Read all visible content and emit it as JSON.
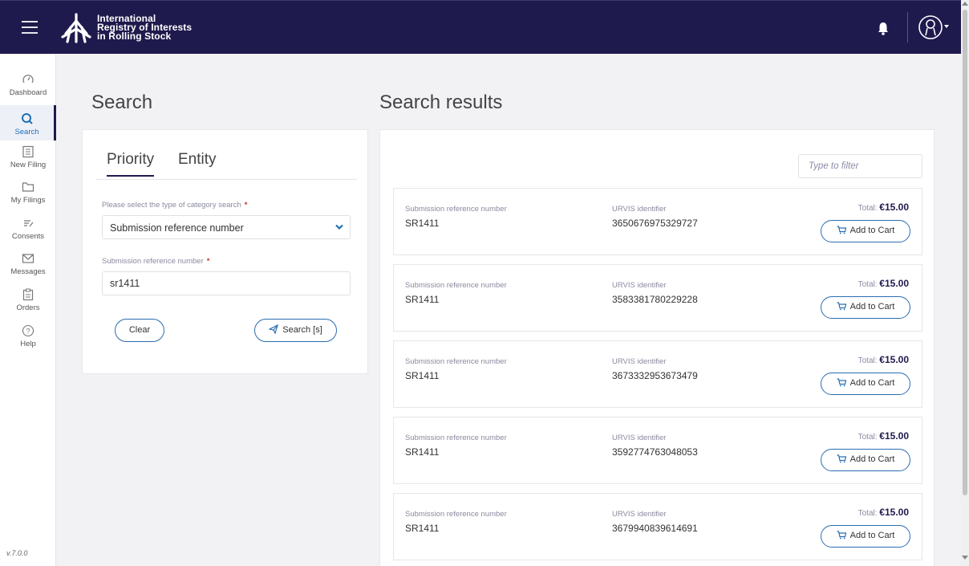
{
  "header": {
    "brand_line1": "International",
    "brand_line2": "Registry of Interests",
    "brand_line3": "in Rolling Stock"
  },
  "sidebar": {
    "items": [
      {
        "label": "Dashboard",
        "icon": "dashboard-icon"
      },
      {
        "label": "Search",
        "icon": "search-icon",
        "active": true
      },
      {
        "label": "New Filing",
        "icon": "new-filing-icon"
      },
      {
        "label": "My Filings",
        "icon": "folder-icon"
      },
      {
        "label": "Consents",
        "icon": "consents-icon"
      },
      {
        "label": "Messages",
        "icon": "envelope-icon"
      },
      {
        "label": "Orders",
        "icon": "clipboard-icon"
      },
      {
        "label": "Help",
        "icon": "help-icon"
      }
    ],
    "version": "v.7.0.0"
  },
  "search": {
    "title": "Search",
    "tabs": [
      "Priority",
      "Entity"
    ],
    "category_label": "Please select the type of category search",
    "category_value": "Submission reference number",
    "ref_label": "Submission reference number",
    "ref_value": "sr1411",
    "required_mark": "*",
    "clear_label": "Clear",
    "search_label": "Search [s]"
  },
  "results": {
    "title": "Search results",
    "filter_placeholder": "Type to filter",
    "col1_label": "Submission reference number",
    "col2_label": "URVIS identifier",
    "total_label": "Total:",
    "cart_label": "Add to Cart",
    "items": [
      {
        "ref": "SR1411",
        "urvis": "3650676975329727",
        "total": "€15.00"
      },
      {
        "ref": "SR1411",
        "urvis": "3583381780229228",
        "total": "€15.00"
      },
      {
        "ref": "SR1411",
        "urvis": "3673332953673479",
        "total": "€15.00"
      },
      {
        "ref": "SR1411",
        "urvis": "3592774763048053",
        "total": "€15.00"
      },
      {
        "ref": "SR1411",
        "urvis": "3679940839614691",
        "total": "€15.00"
      }
    ]
  },
  "colors": {
    "header_bg": "#1f1a4d",
    "accent": "#2b6db3",
    "required": "#c0392b"
  }
}
